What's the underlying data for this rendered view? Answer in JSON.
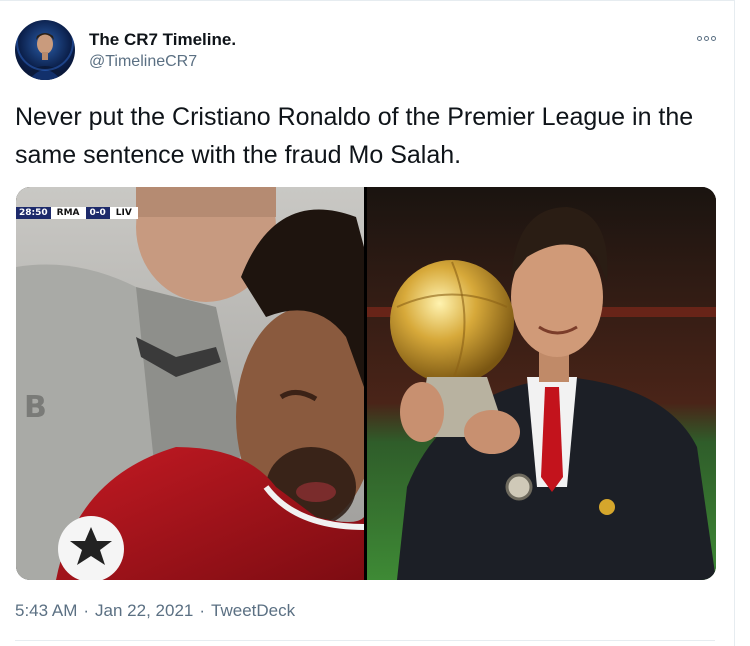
{
  "tweet": {
    "display_name": "The CR7 Timeline.",
    "handle": "@TimelineCR7",
    "text": "Never put the Cristiano Ronaldo of the Premier League in the same sentence with the fraud Mo Salah.",
    "time": "5:43 AM",
    "separator": "·",
    "date": "Jan 22, 2021",
    "source": "TweetDeck"
  },
  "media": {
    "scorebug": {
      "clock": "28:50",
      "home": "RMA",
      "score": "0-0",
      "away": "LIV"
    }
  },
  "icons": {
    "more": "more-options-icon",
    "avatar": "avatar-image"
  },
  "colors": {
    "text": "#0f1419",
    "secondary": "#5b7083",
    "border": "#e6ecf0"
  }
}
